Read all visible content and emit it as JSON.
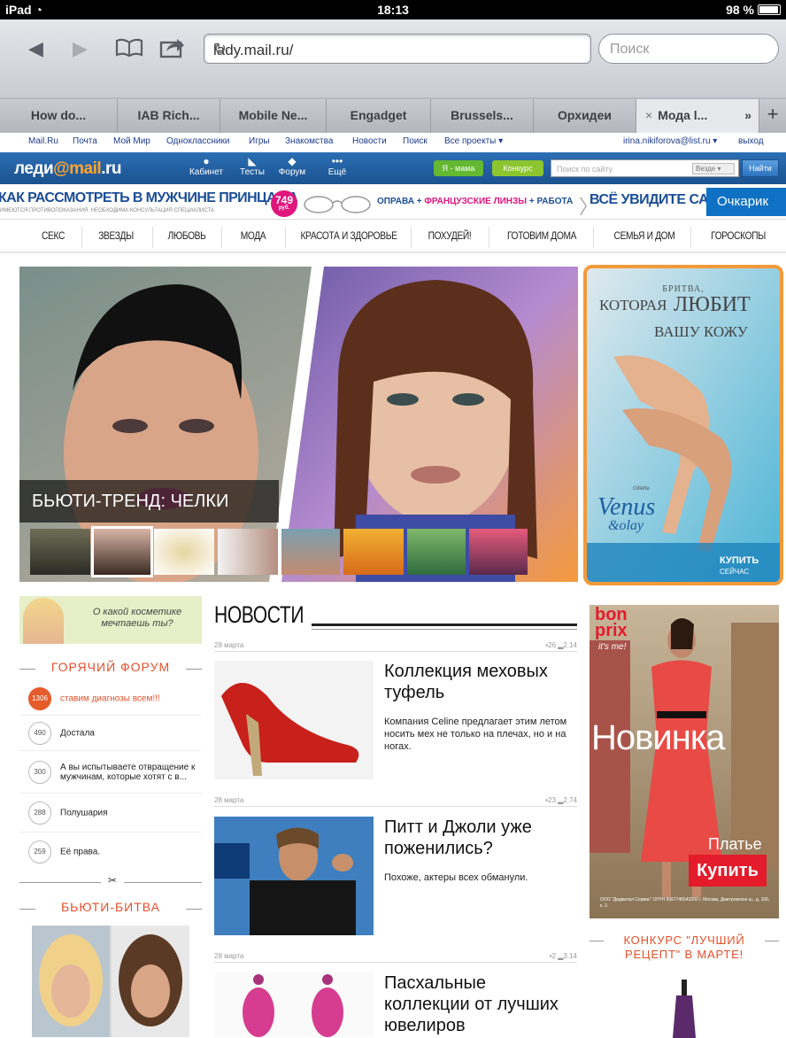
{
  "status": {
    "device": "iPad",
    "time": "18:13",
    "battery": "98 %"
  },
  "browser": {
    "url": "lady.mail.ru/",
    "search_placeholder": "Поиск"
  },
  "tabs": [
    {
      "label": "How do..."
    },
    {
      "label": "IAB Rich..."
    },
    {
      "label": "Mobile Ne..."
    },
    {
      "label": "Engadget"
    },
    {
      "label": "Brussels..."
    },
    {
      "label": "Орхидеи"
    },
    {
      "label": "Мода l...",
      "close": "×",
      "more": "»"
    }
  ],
  "tab_add": "+",
  "portal": {
    "links": [
      "Mail.Ru",
      "Почта",
      "Мой Мир",
      "Одноклассники",
      "Игры",
      "Знакомства",
      "Новости",
      "Поиск",
      "Все проекты ▾"
    ],
    "user": "irina.nikiforova@list.ru ▾",
    "logout": "выход"
  },
  "lady": {
    "logo_a": "леди",
    "logo_b": "@mail",
    "logo_c": ".ru",
    "icons": [
      "Кабинет",
      "Тесты",
      "Форум",
      "Ещё"
    ],
    "btn_mama": "Я - мама",
    "btn_contest": "Конкурс",
    "search_placeholder": "Поиск по сайту",
    "search_scope": "Везде ▾",
    "search_button": "Найти"
  },
  "banner": {
    "headline": "КАК РАССМОТРЕТЬ В МУЖЧИНЕ ПРИНЦА ЗА",
    "fine": "ИМЕЮТСЯ ПРОТИВОПОКАЗАНИЯ. НЕОБХОДИМА КОНСУЛЬТАЦИЯ СПЕЦИАЛИСТА",
    "price": "749",
    "price_unit": "руб.",
    "offer_a": "ОПРАВА + ",
    "offer_b": "ФРАНЦУЗСКИЕ ЛИНЗЫ",
    "offer_c": " + РАБОТА",
    "cta": "ВСЁ УВИДИТЕ САМИ",
    "brand": "Очкарик"
  },
  "nav": [
    "СЕКС",
    "ЗВЕЗДЫ",
    "ЛЮБОВЬ",
    "МОДА",
    "КРАСОТА И ЗДОРОВЬЕ",
    "ПОХУДЕЙ!",
    "ГОТОВИМ ДОМА",
    "СЕМЬЯ И ДОМ",
    "ГОРОСКОПЫ"
  ],
  "hero": {
    "caption": "БЬЮТИ-ТРЕНД: ЧЕЛКИ"
  },
  "ad_right": {
    "l1": "БРИТВА,",
    "l2": "КОТОРАЯ",
    "l3": "ЛЮБИТ",
    "l4": "ВАШУ КОЖУ",
    "brand_a": "Gillette",
    "brand_b": "Venus",
    "brand_c": "&olay",
    "cta": "КУПИТЬ",
    "cta2": "СЕЙЧАС"
  },
  "promo": {
    "text": "О какой косметике мечтаешь ты?"
  },
  "forum": {
    "title": "ГОРЯЧИЙ ФОРУМ",
    "rows": [
      {
        "count": "1306",
        "text": "ставим диагнозы всем!!!"
      },
      {
        "count": "490",
        "text": "Достала"
      },
      {
        "count": "300",
        "text": "А вы испытываете отвращение к мужчинам, которые хотят с в..."
      },
      {
        "count": "288",
        "text": "Полушария"
      },
      {
        "count": "259",
        "text": "Её права."
      }
    ]
  },
  "beauty": {
    "title": "БЬЮТИ-БИТВА"
  },
  "news": {
    "title": "НОВОСТИ",
    "items": [
      {
        "date": "28 марта",
        "comments": "26",
        "views": "2.14",
        "title": "Коллекция меховых туфель",
        "desc": "Компания Celine предлагает этим летом носить мех не только на плечах, но и на ногах."
      },
      {
        "date": "28 марта",
        "comments": "23",
        "views": "2.74",
        "title": "Питт и Джоли уже поженились?",
        "desc": "Похоже, актеры всех обманули."
      },
      {
        "date": "28 марта",
        "comments": "2",
        "views": "3.14",
        "title": "Пасхальные коллекции от лучших ювелиров",
        "desc": ""
      }
    ]
  },
  "ad2": {
    "brand1": "bon",
    "brand2": "prix",
    "tag": "it's me!",
    "headline": "Новинка",
    "product": "Платье",
    "cta": "Купить",
    "legal": "ООО \"Диджитал Сервис\" ОГРН 5067746543200 г. Москва, Дмитровское ш., д. 100, к. 2."
  },
  "contest": {
    "title": "КОНКУРС \"ЛУЧШИЙ РЕЦЕПТ\" В МАРТЕ!"
  }
}
